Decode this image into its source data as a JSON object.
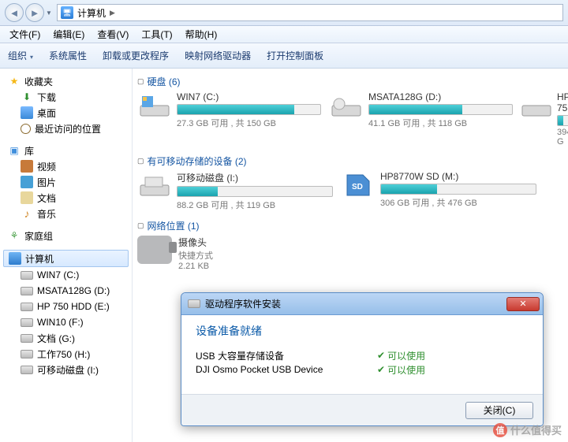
{
  "address": {
    "location": "计算机"
  },
  "menu": {
    "file": "文件(F)",
    "edit": "编辑(E)",
    "view": "查看(V)",
    "tools": "工具(T)",
    "help": "帮助(H)"
  },
  "toolbar": {
    "organize": "组织",
    "props": "系统属性",
    "uninstall": "卸载或更改程序",
    "netdrive": "映射网络驱动器",
    "cpanel": "打开控制面板"
  },
  "sidebar": {
    "favorites": "收藏夹",
    "fav_items": {
      "downloads": "下载",
      "desktop": "桌面",
      "recent": "最近访问的位置"
    },
    "libraries": "库",
    "lib_items": {
      "videos": "视频",
      "pictures": "图片",
      "documents": "文档",
      "music": "音乐"
    },
    "homegroup": "家庭组",
    "computer": "计算机",
    "drives": {
      "c": "WIN7 (C:)",
      "d": "MSATA128G (D:)",
      "e": "HP 750 HDD (E:)",
      "f": "WIN10 (F:)",
      "g": "文档 (G:)",
      "h": "工作750 (H:)",
      "i": "可移动磁盘 (I:)"
    }
  },
  "sections": {
    "hdd": "硬盘 (6)",
    "removable": "有可移动存储的设备 (2)",
    "network": "网络位置 (1)"
  },
  "drives": {
    "c": {
      "name": "WIN7 (C:)",
      "sub": "27.3 GB 可用 , 共 150 GB",
      "fill": 82
    },
    "d": {
      "name": "MSATA128G (D:)",
      "sub": "41.1 GB 可用 , 共 118 GB",
      "fill": 65
    },
    "e": {
      "name": "HP 75",
      "sub": "394 G",
      "fill": 45
    },
    "i": {
      "name": "可移动磁盘 (I:)",
      "sub": "88.2 GB 可用 , 共 119 GB",
      "fill": 26
    },
    "m": {
      "name": "HP8770W SD (M:)",
      "sub": "306 GB 可用 , 共 476 GB",
      "fill": 36
    }
  },
  "netloc": {
    "name": "摄像头",
    "type": "快捷方式",
    "size": "2.21 KB"
  },
  "dialog": {
    "title": "驱动程序软件安装",
    "heading": "设备准备就绪",
    "rows": [
      {
        "name": "USB 大容量存储设备",
        "status": "可以使用"
      },
      {
        "name": "DJI Osmo Pocket USB Device",
        "status": "可以使用"
      }
    ],
    "close_btn": "关闭(C)"
  },
  "watermark": "什么值得买"
}
